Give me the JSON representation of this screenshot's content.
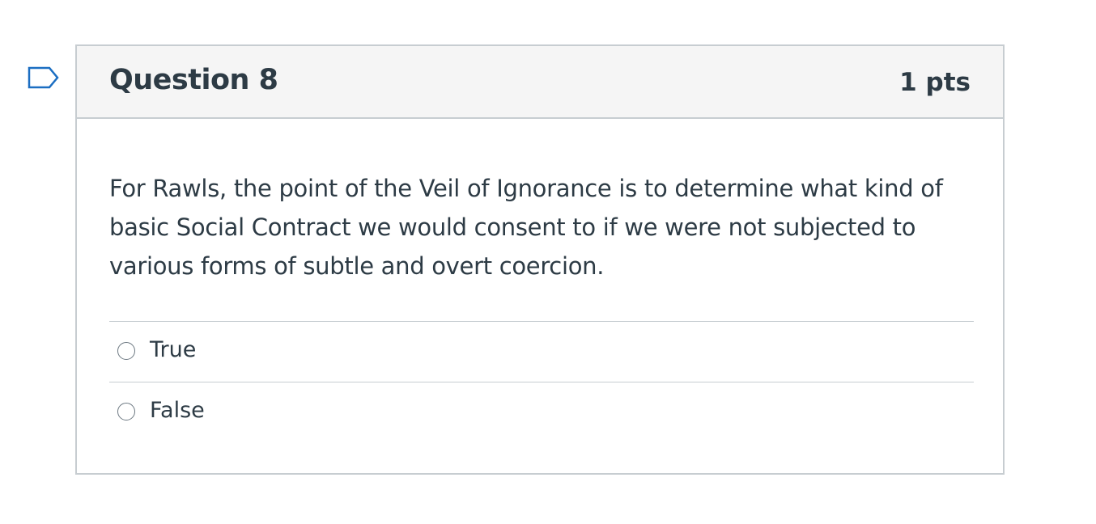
{
  "flag_icon": "bookmark-flag-icon",
  "question": {
    "title": "Question 8",
    "points": "1 pts",
    "text": "For Rawls, the point of the Veil of Ignorance is to determine what kind of basic Social Contract we would consent to if we were not subjected to various forms of subtle and overt coercion.",
    "answers": [
      {
        "label": "True"
      },
      {
        "label": "False"
      }
    ]
  },
  "colors": {
    "text": "#2d3b45",
    "border": "#c7cdd1",
    "header_bg": "#f5f5f5",
    "flag": "#1b6ec2"
  }
}
